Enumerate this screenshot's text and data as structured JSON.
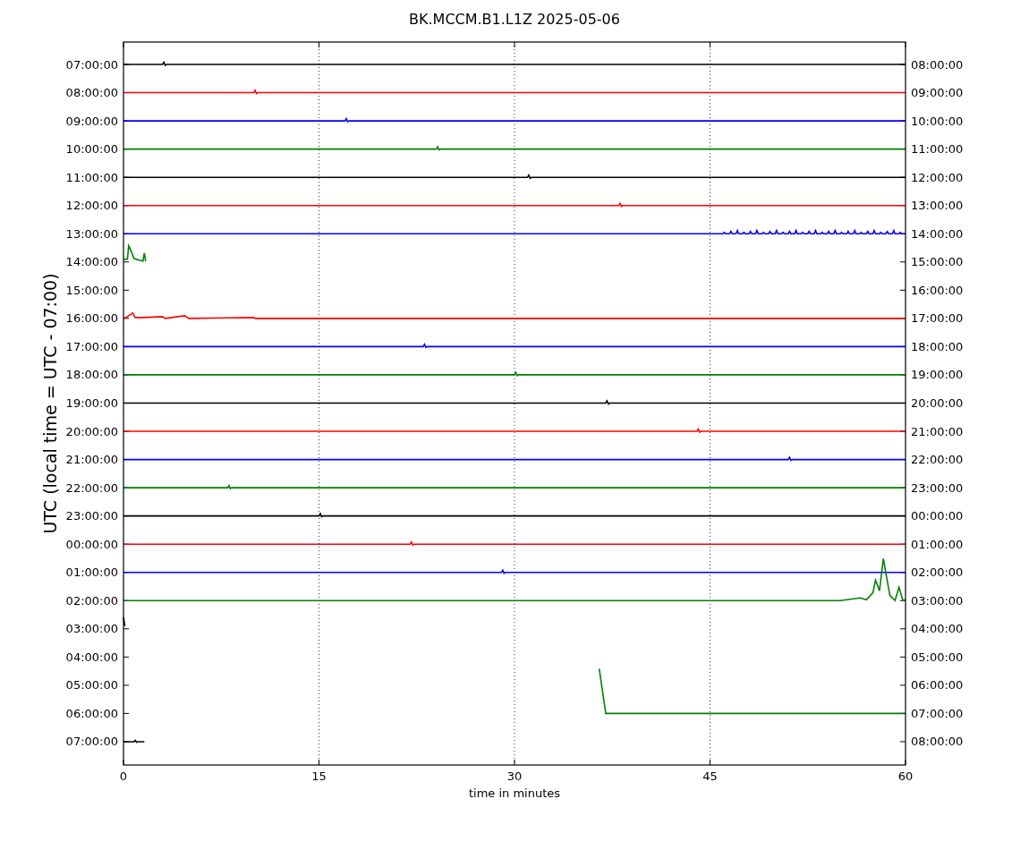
{
  "chart": {
    "title": "BK.MCCM.B1.L1Z 2025-05-06",
    "ylabel": "UTC (local time = UTC - 07:00)",
    "xlabel": "time in minutes",
    "xticks": [
      "0",
      "15",
      "30",
      "45",
      "60"
    ],
    "rows": [
      {
        "left": "07:00:00",
        "right": "08:00:00",
        "color": "#000000"
      },
      {
        "left": "08:00:00",
        "right": "09:00:00",
        "color": "#ff0000"
      },
      {
        "left": "09:00:00",
        "right": "10:00:00",
        "color": "#0000ff"
      },
      {
        "left": "10:00:00",
        "right": "11:00:00",
        "color": "#008000"
      },
      {
        "left": "11:00:00",
        "right": "12:00:00",
        "color": "#000000"
      },
      {
        "left": "12:00:00",
        "right": "13:00:00",
        "color": "#ff0000"
      },
      {
        "left": "13:00:00",
        "right": "14:00:00",
        "color": "#0000ff"
      },
      {
        "left": "14:00:00",
        "right": "15:00:00",
        "color": "#008000"
      },
      {
        "left": "15:00:00",
        "right": "16:00:00"
      },
      {
        "left": "16:00:00",
        "right": "17:00:00",
        "color": "#ff0000"
      },
      {
        "left": "17:00:00",
        "right": "18:00:00",
        "color": "#0000ff"
      },
      {
        "left": "18:00:00",
        "right": "19:00:00",
        "color": "#008000"
      },
      {
        "left": "19:00:00",
        "right": "20:00:00",
        "color": "#000000"
      },
      {
        "left": "20:00:00",
        "right": "21:00:00",
        "color": "#ff0000"
      },
      {
        "left": "21:00:00",
        "right": "22:00:00",
        "color": "#0000ff"
      },
      {
        "left": "22:00:00",
        "right": "23:00:00",
        "color": "#008000"
      },
      {
        "left": "23:00:00",
        "right": "00:00:00",
        "color": "#000000"
      },
      {
        "left": "00:00:00",
        "right": "01:00:00",
        "color": "#ff0000"
      },
      {
        "left": "01:00:00",
        "right": "02:00:00",
        "color": "#0000ff"
      },
      {
        "left": "02:00:00",
        "right": "03:00:00",
        "color": "#008000"
      },
      {
        "left": "03:00:00",
        "right": "04:00:00",
        "color": "#000000"
      },
      {
        "left": "04:00:00",
        "right": "05:00:00"
      },
      {
        "left": "05:00:00",
        "right": "06:00:00"
      },
      {
        "left": "06:00:00",
        "right": "07:00:00",
        "color": "#008000"
      },
      {
        "left": "07:00:00",
        "right": "08:00:00",
        "color": "#000000"
      }
    ]
  }
}
